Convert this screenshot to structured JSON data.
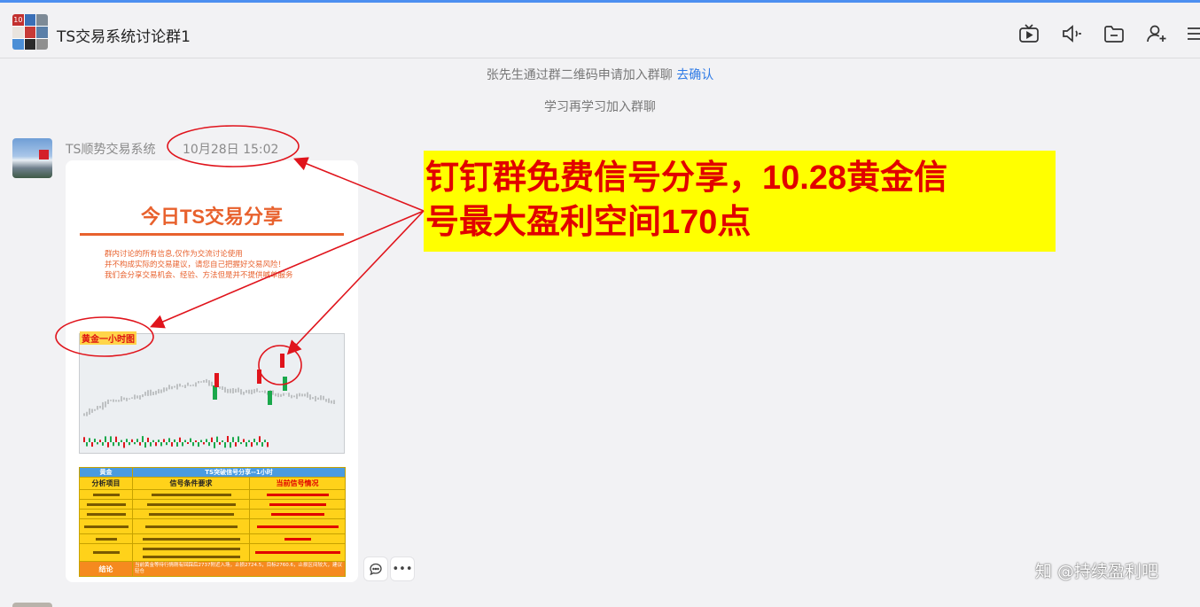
{
  "header": {
    "title": "TS交易系统讨论群1",
    "group_avatar_badge": "10",
    "icons": [
      "live-icon",
      "speaker-icon",
      "folder-icon",
      "add-member-icon",
      "more-icon"
    ]
  },
  "system_messages": {
    "join_request_text": "张先生通过群二维码申请加入群聊",
    "join_request_link": "去确认",
    "joined_text": "学习再学习加入群聊"
  },
  "message": {
    "sender": "TS顺势交易系统",
    "time": "10月28日 15:02",
    "poster": {
      "title": "今日TS交易分享",
      "lines": [
        "群内讨论的所有信息,仅作为交流讨论使用",
        "并不构成实际的交易建议，请您自己把握好交易风险！",
        "我们会分享交易机会、经验、方法但是并不提供喊单服务"
      ],
      "chart_label": "黄金一小时图",
      "table": {
        "header_left": "黄金",
        "header_right": "TS突破信号分享--1小时",
        "col1": "分析项目",
        "col2": "信号条件要求",
        "col3": "当前信号情况",
        "conclusion_label": "结论",
        "conclusion_text": "当前黄金等待行情刚有回踩后2737附近入场，止损2724.5，目标2760.6，止损区间较大，建议轻仓"
      }
    }
  },
  "banner": {
    "line1": "钉钉群免费信号分享，10.28黄金信",
    "line2": "号最大盈利空间170点"
  },
  "actions": {
    "comment_icon": "comment-icon",
    "more_label": "•••"
  },
  "watermark": "知 @持续盈利吧",
  "colors": {
    "accent": "#2f7be6",
    "poster_orange": "#e8612d",
    "banner_bg": "#ffff00",
    "banner_text": "#e10000",
    "annotation_red": "#e0141c",
    "table_header_blue": "#4a9be0",
    "table_yellow": "#ffd21a"
  }
}
